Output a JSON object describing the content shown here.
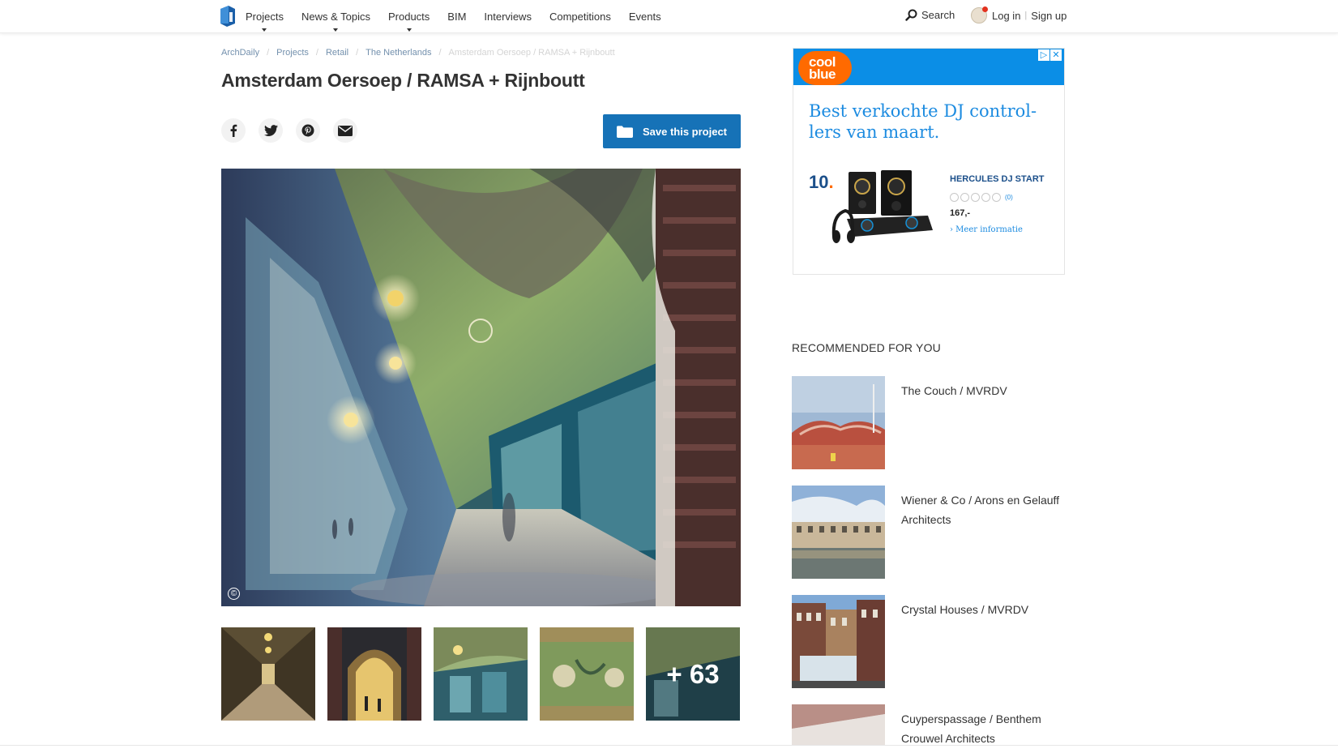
{
  "header": {
    "logo_icon": "archdaily-logo-icon",
    "nav": [
      {
        "label": "Projects",
        "has_dropdown": true
      },
      {
        "label": "News & Topics",
        "has_dropdown": true
      },
      {
        "label": "Products",
        "has_dropdown": true
      },
      {
        "label": "BIM",
        "has_dropdown": false
      },
      {
        "label": "Interviews",
        "has_dropdown": false
      },
      {
        "label": "Competitions",
        "has_dropdown": false
      },
      {
        "label": "Events",
        "has_dropdown": false
      }
    ],
    "search_label": "Search",
    "login_label": "Log in",
    "separator": "|",
    "signup_label": "Sign up"
  },
  "breadcrumb": [
    "ArchDaily",
    "Projects",
    "Retail",
    "The Netherlands",
    "Amsterdam Oersoep / RAMSA + Rijnboutt"
  ],
  "page_title": "Amsterdam Oersoep / RAMSA + Rijnboutt",
  "share": {
    "icons": [
      "facebook-icon",
      "twitter-icon",
      "pinterest-icon",
      "email-icon"
    ]
  },
  "save_button": {
    "label": "Save this project",
    "icon": "folder-icon",
    "color": "#1672b7"
  },
  "hero": {
    "copyright_symbol": "©"
  },
  "thumbnails": {
    "more_count": "+ 63"
  },
  "ad": {
    "brand": "cool blue",
    "brand_line1": "cool",
    "brand_line2": "blue",
    "icon_adchoices": "▷",
    "icon_close": "✕",
    "headline": "Best verkochte DJ control-lers van maart.",
    "rank": "10",
    "rank_dot": ".",
    "product_name": "HERCULES DJ START",
    "reviews": "(0)",
    "price": "167,-",
    "more_link": "› Meer informatie",
    "colors": {
      "header": "#0b8ee6",
      "brand": "#ff6a00",
      "text": "#1c8be0"
    }
  },
  "recommended": {
    "heading": "RECOMMENDED FOR YOU",
    "items": [
      {
        "title": "The Couch / MVRDV"
      },
      {
        "title": "Wiener & Co / Arons en Gelauff Architects"
      },
      {
        "title": "Crystal Houses / MVRDV"
      },
      {
        "title": "Cuyperspassage / Benthem Crouwel Architects"
      }
    ]
  }
}
